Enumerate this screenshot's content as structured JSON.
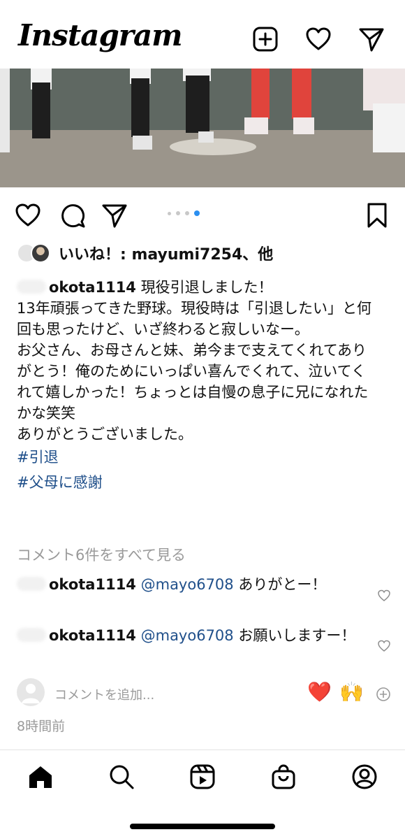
{
  "header": {
    "logo": "Instagram",
    "icons": [
      "add-post-icon",
      "heart-icon",
      "direct-message-icon"
    ]
  },
  "post": {
    "carousel": {
      "total_slides": 4,
      "active_slide": 4
    },
    "likes_text": "いいね！: mayumi7254、他",
    "caption": {
      "username": "okota1114",
      "lines": [
        "現役引退しました！",
        "13年頑張ってきた野球。現役時は「引退したい」と何回も思ったけど、いざ終わると寂しいなー。",
        "お父さん、お母さんと妹、弟今まで支えてくれてありがとう！俺のためにいっぱい喜んでくれて、泣いてくれて嬉しかった！ちょっとは自慢の息子に兄になれたかな笑笑",
        "ありがとうございました。"
      ],
      "hashtags": [
        "#引退",
        "#父母に感謝"
      ]
    },
    "view_all_comments": "コメント6件をすべて見る",
    "comments": [
      {
        "username": "okota1114",
        "mention": "@mayo6708",
        "text": "ありがとー！"
      },
      {
        "username": "okota1114",
        "mention": "@mayo6708",
        "text": "お願いしますー！"
      }
    ],
    "add_comment_placeholder": "コメントを追加...",
    "quick_emojis": [
      "❤️",
      "🙌"
    ],
    "timestamp": "8時間前"
  },
  "bottom_nav": [
    "home-icon",
    "search-icon",
    "reels-icon",
    "shop-icon",
    "profile-icon"
  ],
  "colors": {
    "link": "#1f4f8a",
    "muted": "#9a9a9a",
    "active_dot": "#2b8ff0"
  }
}
